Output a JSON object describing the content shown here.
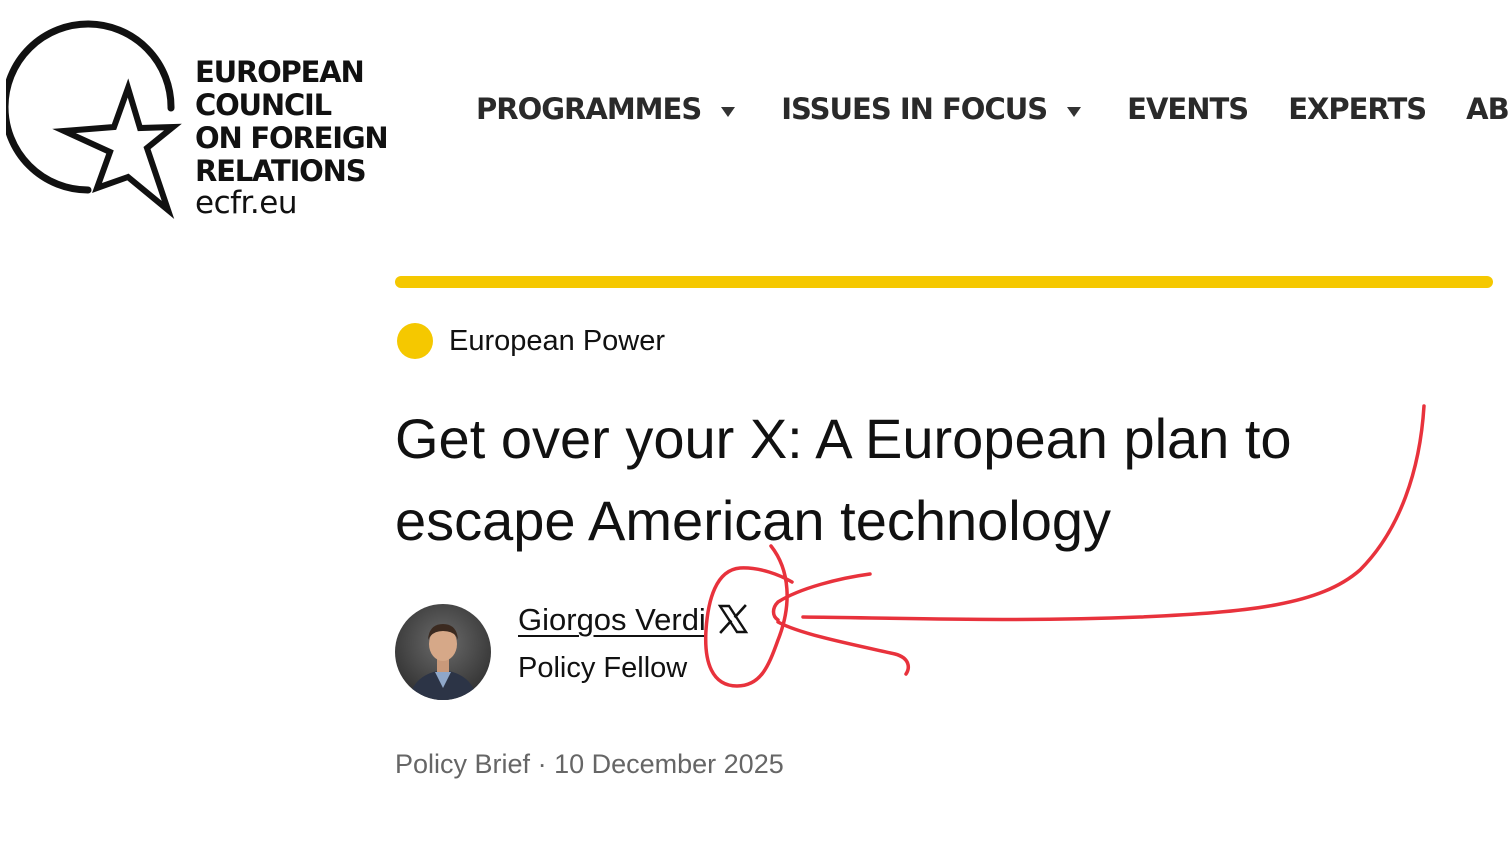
{
  "logo": {
    "lines": [
      "EUROPEAN",
      "COUNCIL",
      "ON FOREIGN",
      "RELATIONS"
    ],
    "domain": "ecfr.eu"
  },
  "nav": {
    "items": [
      {
        "label": "PROGRAMMES",
        "has_dropdown": true
      },
      {
        "label": "ISSUES IN FOCUS",
        "has_dropdown": true
      },
      {
        "label": "EVENTS",
        "has_dropdown": false
      },
      {
        "label": "EXPERTS",
        "has_dropdown": false
      },
      {
        "label": "ABO",
        "has_dropdown": false
      }
    ]
  },
  "article": {
    "topic": "European Power",
    "title_line1": "Get over your X: A European plan to",
    "title_line2": "escape American technology",
    "author": {
      "name": "Giorgos Verdi",
      "role": "Policy Fellow",
      "social_icon": "x-icon"
    },
    "type": "Policy Brief",
    "separator": "·",
    "date": "10 December 2025"
  },
  "colors": {
    "accent_yellow": "#f5c800",
    "annotation_red": "#e8323c",
    "meta_gray": "#666666"
  }
}
